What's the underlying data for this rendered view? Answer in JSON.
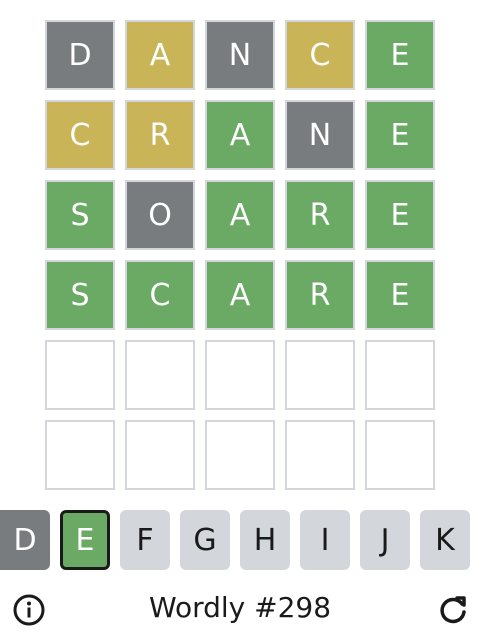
{
  "board": {
    "rows": [
      [
        {
          "letter": "D",
          "state": "absent"
        },
        {
          "letter": "A",
          "state": "present"
        },
        {
          "letter": "N",
          "state": "absent"
        },
        {
          "letter": "C",
          "state": "present"
        },
        {
          "letter": "E",
          "state": "correct"
        }
      ],
      [
        {
          "letter": "C",
          "state": "present"
        },
        {
          "letter": "R",
          "state": "present"
        },
        {
          "letter": "A",
          "state": "correct"
        },
        {
          "letter": "N",
          "state": "absent"
        },
        {
          "letter": "E",
          "state": "correct"
        }
      ],
      [
        {
          "letter": "S",
          "state": "correct"
        },
        {
          "letter": "O",
          "state": "absent"
        },
        {
          "letter": "A",
          "state": "correct"
        },
        {
          "letter": "R",
          "state": "correct"
        },
        {
          "letter": "E",
          "state": "correct"
        }
      ],
      [
        {
          "letter": "S",
          "state": "correct"
        },
        {
          "letter": "C",
          "state": "correct"
        },
        {
          "letter": "A",
          "state": "correct"
        },
        {
          "letter": "R",
          "state": "correct"
        },
        {
          "letter": "E",
          "state": "correct"
        }
      ],
      [
        {
          "letter": "",
          "state": "empty"
        },
        {
          "letter": "",
          "state": "empty"
        },
        {
          "letter": "",
          "state": "empty"
        },
        {
          "letter": "",
          "state": "empty"
        },
        {
          "letter": "",
          "state": "empty"
        }
      ],
      [
        {
          "letter": "",
          "state": "empty"
        },
        {
          "letter": "",
          "state": "empty"
        },
        {
          "letter": "",
          "state": "empty"
        },
        {
          "letter": "",
          "state": "empty"
        },
        {
          "letter": "",
          "state": "empty"
        }
      ]
    ]
  },
  "keyboard": {
    "keys": [
      {
        "label": "D",
        "state": "absent"
      },
      {
        "label": "E",
        "state": "correct"
      },
      {
        "label": "F",
        "state": "unused"
      },
      {
        "label": "G",
        "state": "unused"
      },
      {
        "label": "H",
        "state": "unused"
      },
      {
        "label": "I",
        "state": "unused"
      },
      {
        "label": "J",
        "state": "unused"
      },
      {
        "label": "K",
        "state": "unused"
      }
    ]
  },
  "footer": {
    "title": "Wordly #298",
    "info_icon": "info-icon",
    "restart_icon": "restart-icon"
  },
  "colors": {
    "absent": "#787c7e",
    "present": "#c9b458",
    "correct": "#6aaa64",
    "empty_border": "#d3d6da",
    "key_unused": "#d3d6da",
    "text_dark": "#1a1a1b"
  }
}
